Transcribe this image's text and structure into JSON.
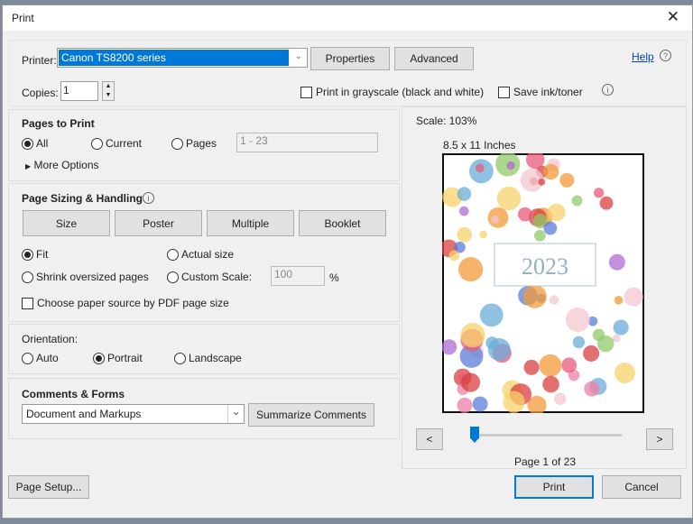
{
  "title": "Print",
  "printer": {
    "label": "Printer:",
    "value": "Canon TS8200 series",
    "properties": "Properties",
    "advanced": "Advanced",
    "help": "Help"
  },
  "copies": {
    "label": "Copies:",
    "value": "1"
  },
  "grayscale": {
    "label": "Print in grayscale (black and white)",
    "checked": false
  },
  "save_ink": {
    "label": "Save ink/toner",
    "checked": false
  },
  "pages_to_print": {
    "title": "Pages to Print",
    "all": "All",
    "current": "Current",
    "pages": "Pages",
    "range": "1 - 23",
    "more": "More Options",
    "selected": "All"
  },
  "sizing": {
    "title": "Page Sizing & Handling",
    "tabs": [
      "Size",
      "Poster",
      "Multiple",
      "Booklet"
    ],
    "fit": "Fit",
    "actual": "Actual size",
    "shrink": "Shrink oversized pages",
    "custom": "Custom Scale:",
    "custom_value": "100",
    "percent": "%",
    "paper_source": "Choose paper source by PDF page size",
    "selected": "Fit"
  },
  "orientation": {
    "title": "Orientation:",
    "auto": "Auto",
    "portrait": "Portrait",
    "landscape": "Landscape",
    "selected": "Portrait"
  },
  "comments": {
    "title": "Comments & Forms",
    "value": "Document and Markups",
    "summarize": "Summarize Comments"
  },
  "preview": {
    "scale": "Scale: 103%",
    "paper": "8.5 x 11 Inches",
    "page_text": "2023",
    "prev": "<",
    "next": ">",
    "page_label": "Page 1 of 23",
    "slider_fraction": 0.0
  },
  "footer": {
    "page_setup": "Page Setup...",
    "print": "Print",
    "cancel": "Cancel"
  }
}
